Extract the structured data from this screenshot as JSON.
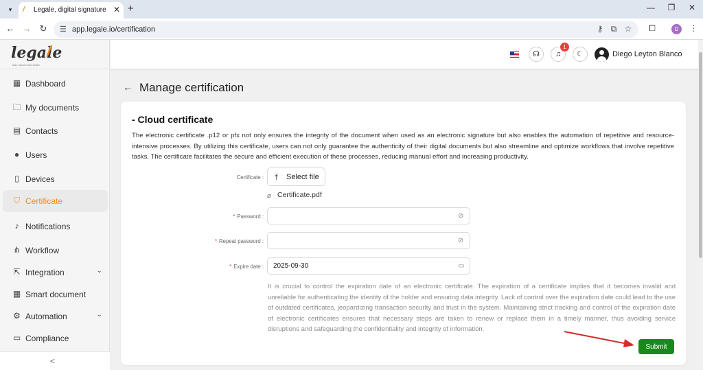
{
  "browser": {
    "tab_title": "Legale, digital signature",
    "tab_close": "✕",
    "new_tab": "+",
    "url": "app.legale.io/certification",
    "profile_initial": "D"
  },
  "app": {
    "logo_text": "legale",
    "logo_mark": "/",
    "logo_tagline": "fast, secure and smart",
    "user_name": "Diego Leyton Blanco",
    "notification_count": "1"
  },
  "sidebar": {
    "items": [
      {
        "label": "Dashboard",
        "icon": "dashboard-icon"
      },
      {
        "label": "My documents",
        "icon": "folder-icon"
      },
      {
        "label": "Contacts",
        "icon": "contacts-icon"
      },
      {
        "label": "Users",
        "icon": "user-icon"
      },
      {
        "label": "Devices",
        "icon": "device-icon"
      },
      {
        "label": "Certificate",
        "icon": "certificate-icon"
      },
      {
        "label": "Notifications",
        "icon": "bell-icon"
      },
      {
        "label": "Workflow",
        "icon": "workflow-icon"
      },
      {
        "label": "Integration",
        "icon": "integration-icon"
      },
      {
        "label": "Smart document",
        "icon": "smart-document-icon"
      },
      {
        "label": "Automation",
        "icon": "automation-icon"
      },
      {
        "label": "Compliance",
        "icon": "compliance-icon"
      }
    ],
    "active": "Certificate",
    "collapse_label": "<"
  },
  "page": {
    "title": "Manage certification",
    "section_title": "- Cloud certificate",
    "description": "The electronic certificate .p12 or pfx not only ensures the integrity of the document when used as an electronic signature but also enables the automation of repetitive and resource-intensive processes. By utilizing this certificate, users can not only guarantee the authenticity of their digital documents but also streamline and optimize workflows that involve repetitive tasks. The certificate facilitates the secure and efficient execution of these processes, reducing manual effort and increasing productivity."
  },
  "form": {
    "certificate_label": "Certificate :",
    "select_file_label": "Select file",
    "file_name": "Certificate.pdf",
    "password_label": "Password :",
    "password_value": "",
    "repeat_password_label": "Repeat password :",
    "repeat_password_value": "",
    "expire_label": "Expire date :",
    "expire_value": "2025-09-30",
    "required_mark": "*",
    "help_text": "It is crucial to control the expiration date of an electronic certificate. The expiration of a certificate implies that it becomes invalid and unreliable for authenticating the identity of the holder and ensuring data integrity. Lack of control over the expiration date could lead to the use of outdated certificates, jeopardizing transaction security and trust in the system. Maintaining strict tracking and control of the expiration date of electronic certificates ensures that necessary steps are taken to renew or replace them in a timely manner, thus avoiding service disruptions and safeguarding the confidentiality and integrity of information.",
    "submit_label": "Submit"
  },
  "colors": {
    "accent": "#ef8c2b",
    "submit": "#178a17",
    "badge": "#e9403b",
    "annotation_arrow": "#d62a2a"
  }
}
